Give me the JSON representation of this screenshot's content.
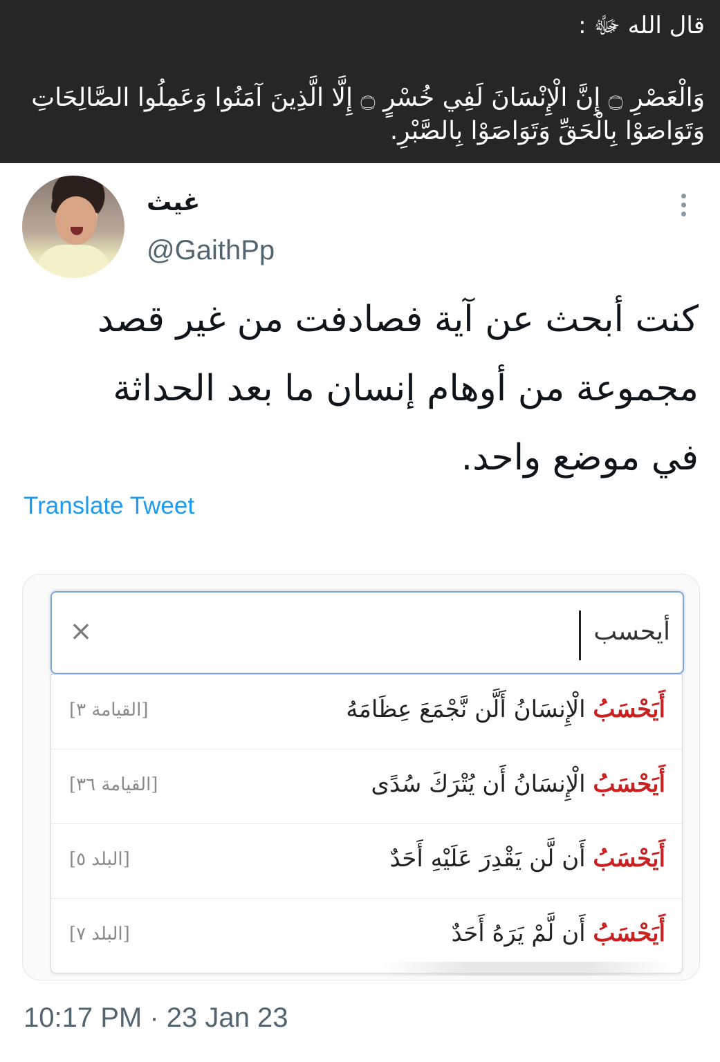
{
  "banner": {
    "heading": "قال الله ﷻ :",
    "verse": "وَالْعَصْرِ ۝ إِنَّ الْإِنْسَانَ لَفِي خُسْرٍ ۝ إِلَّا الَّذِينَ آمَنُوا وَعَمِلُوا الصَّالِحَاتِ وَتَوَاصَوْا بِالْحَقِّ وَتَوَاصَوْا بِالصَّبْرِ."
  },
  "tweet": {
    "display_name": "غيث",
    "handle": "@GaithPp",
    "text_lines": [
      "كنت أبحث عن آية فصادفت من غير قصد",
      "مجموعة من أوهام إنسان ما بعد الحداثة",
      "في موضع واحد."
    ],
    "translate_label": "Translate Tweet",
    "timestamp": "10:17 PM · 23 Jan 23"
  },
  "search": {
    "value": "أيحسب",
    "clear_icon": "×",
    "results": [
      {
        "keyword": "أَيَحْسَبُ",
        "rest": " الْإِنسَانُ أَلَّن نَّجْمَعَ عِظَامَهُ",
        "ref": "[القيامة ٣]"
      },
      {
        "keyword": "أَيَحْسَبُ",
        "rest": " الْإِنسَانُ أَن يُتْرَكَ سُدًى",
        "ref": "[القيامة ٣٦]"
      },
      {
        "keyword": "أَيَحْسَبُ",
        "rest": " أَن لَّن يَقْدِرَ عَلَيْهِ أَحَدٌ",
        "ref": "[البلد ٥]"
      },
      {
        "keyword": "أَيَحْسَبُ",
        "rest": " أَن لَّمْ يَرَهُ أَحَدٌ",
        "ref": "[البلد ٧]"
      }
    ]
  },
  "colors": {
    "banner_bg": "#262626",
    "keyword_red": "#cc1f1f",
    "link_blue": "#1d9bf0",
    "muted": "#536471"
  }
}
